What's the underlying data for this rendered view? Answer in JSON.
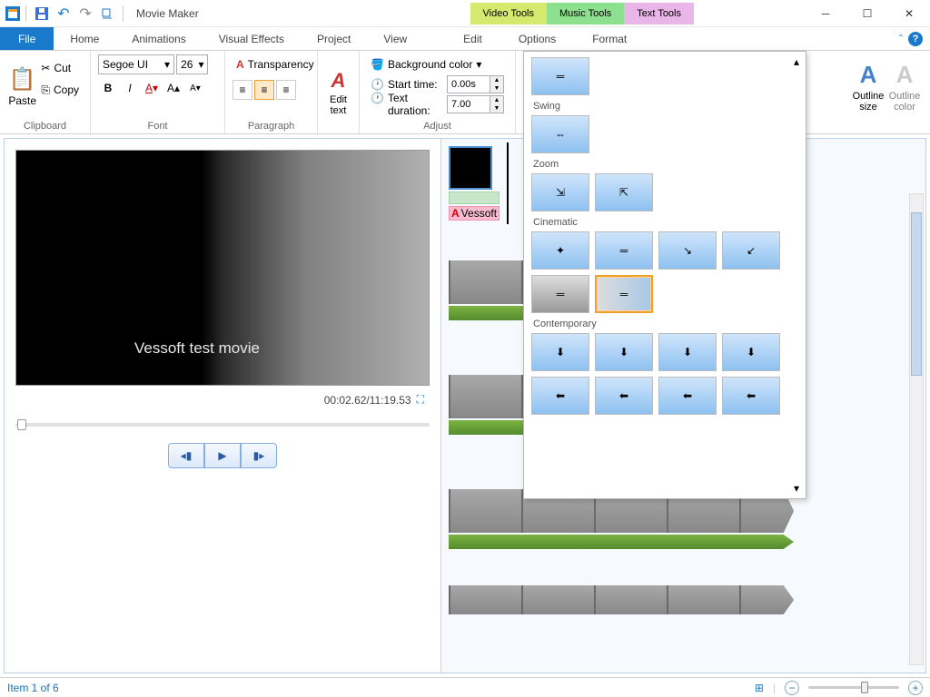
{
  "titlebar": {
    "app_title": "Movie Maker"
  },
  "tool_tabs": {
    "video": "Video Tools",
    "music": "Music Tools",
    "text": "Text Tools"
  },
  "menu": {
    "file": "File",
    "items": [
      "Home",
      "Animations",
      "Visual Effects",
      "Project",
      "View"
    ],
    "sub_items": [
      "Edit",
      "Options",
      "Format"
    ]
  },
  "ribbon": {
    "clipboard": {
      "label": "Clipboard",
      "paste": "Paste",
      "cut": "Cut",
      "copy": "Copy"
    },
    "font": {
      "label": "Font",
      "family": "Segoe UI",
      "size": "26"
    },
    "paragraph": {
      "label": "Paragraph",
      "transparency": "Transparency",
      "edit_text": "Edit\ntext"
    },
    "adjust": {
      "label": "Adjust",
      "bg": "Background color",
      "start": "Start time:",
      "start_val": "0.00s",
      "dur": "Text duration:",
      "dur_val": "7.00"
    },
    "outline_size": "Outline\nsize",
    "outline_color": "Outline\ncolor"
  },
  "preview": {
    "overlay_text": "Vessoft test movie",
    "time": "00:02.62/11:19.53"
  },
  "timeline": {
    "text_clip_label": "Vessoft"
  },
  "effects": {
    "categories": [
      "Swing",
      "Zoom",
      "Cinematic",
      "Contemporary"
    ]
  },
  "statusbar": {
    "item": "Item 1 of 6"
  }
}
